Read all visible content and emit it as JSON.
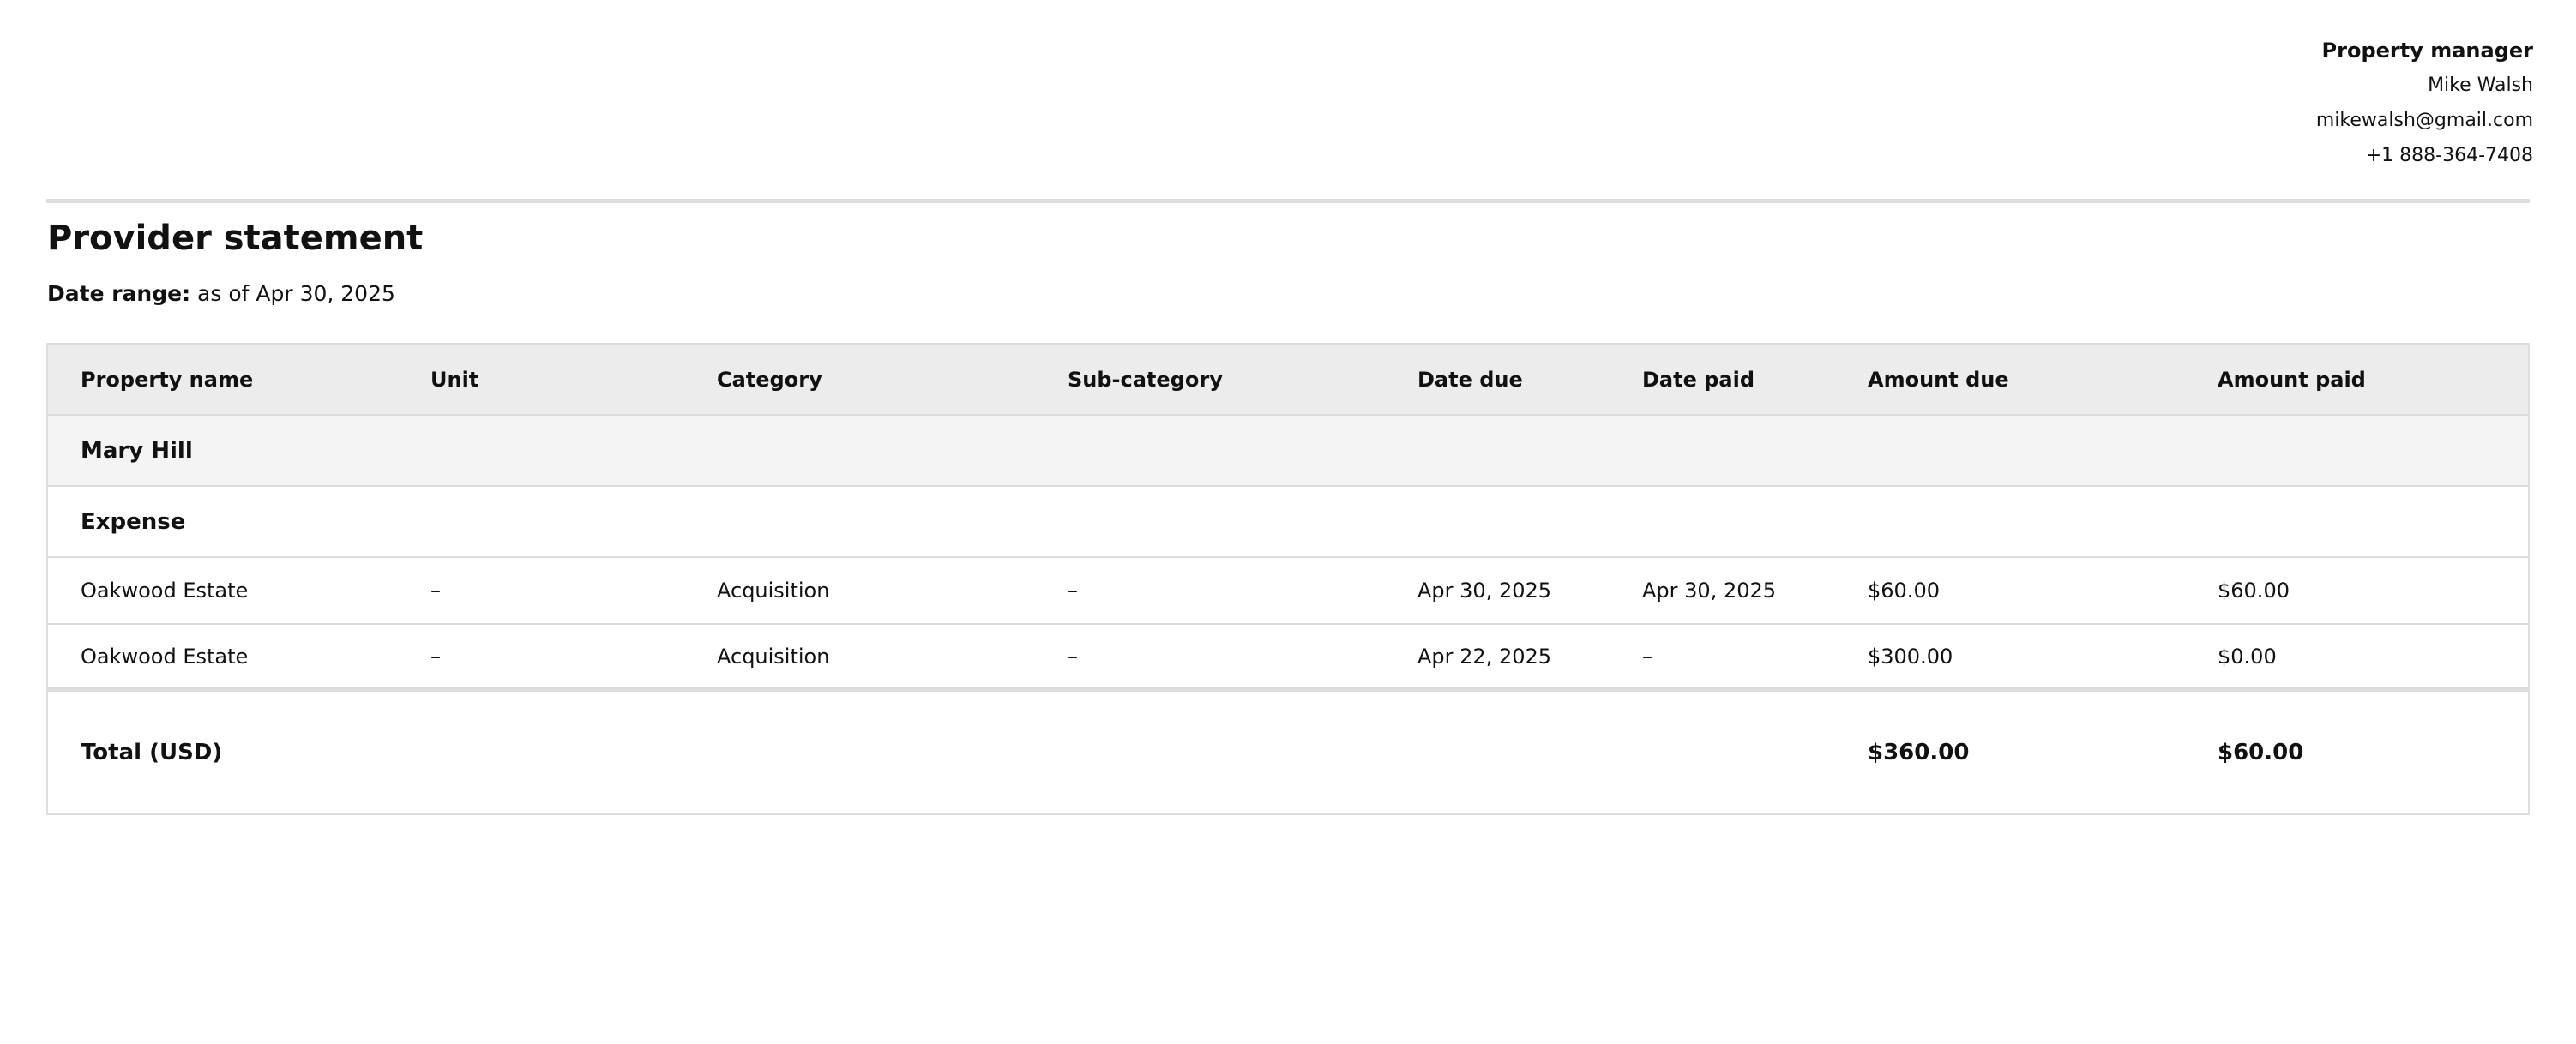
{
  "manager": {
    "role_label": "Property manager",
    "name": "Mike Walsh",
    "email": "mikewalsh@gmail.com",
    "phone": "+1 888-364-7408"
  },
  "title": "Provider statement",
  "date_range": {
    "label": "Date range:",
    "value": "as of Apr 30, 2025"
  },
  "table": {
    "columns": [
      "Property name",
      "Unit",
      "Category",
      "Sub-category",
      "Date due",
      "Date paid",
      "Amount due",
      "Amount paid"
    ],
    "group": "Mary Hill",
    "section": "Expense",
    "rows": [
      [
        "Oakwood Estate",
        "–",
        "Acquisition",
        "–",
        "Apr 30, 2025",
        "Apr 30, 2025",
        "$60.00",
        "$60.00"
      ],
      [
        "Oakwood Estate",
        "–",
        "Acquisition",
        "–",
        "Apr 22, 2025",
        "–",
        "$300.00",
        "$0.00"
      ]
    ],
    "total": {
      "label": "Total (USD)",
      "amount_due": "$360.00",
      "amount_paid": "$60.00"
    }
  }
}
